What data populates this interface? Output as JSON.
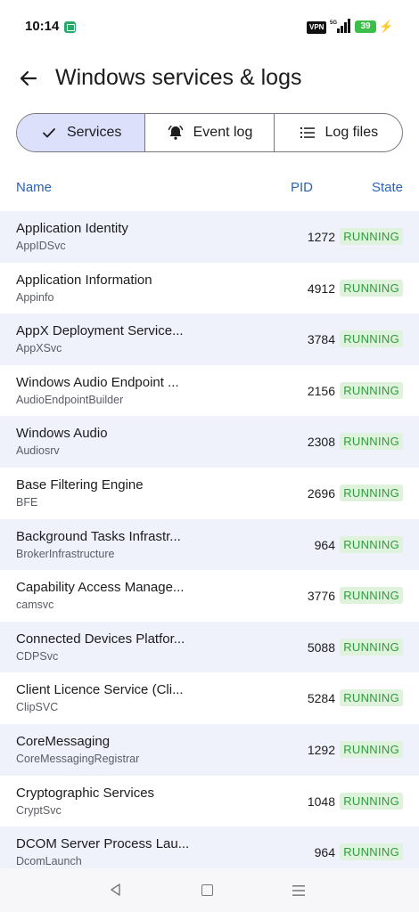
{
  "status_bar": {
    "time": "10:14",
    "vpn": "VPN",
    "battery": "39"
  },
  "header": {
    "title": "Windows services & logs"
  },
  "tabs": [
    {
      "label": "Services",
      "icon": "check-icon",
      "active": true
    },
    {
      "label": "Event log",
      "icon": "bell-icon",
      "active": false
    },
    {
      "label": "Log files",
      "icon": "list-icon",
      "active": false
    }
  ],
  "columns": {
    "name": "Name",
    "pid": "PID",
    "state": "State"
  },
  "services": [
    {
      "name": "Application Identity",
      "id": "AppIDSvc",
      "pid": "1272",
      "state": "RUNNING"
    },
    {
      "name": "Application Information",
      "id": "Appinfo",
      "pid": "4912",
      "state": "RUNNING"
    },
    {
      "name": "AppX Deployment Service...",
      "id": "AppXSvc",
      "pid": "3784",
      "state": "RUNNING"
    },
    {
      "name": "Windows Audio Endpoint ...",
      "id": "AudioEndpointBuilder",
      "pid": "2156",
      "state": "RUNNING"
    },
    {
      "name": "Windows Audio",
      "id": "Audiosrv",
      "pid": "2308",
      "state": "RUNNING"
    },
    {
      "name": "Base Filtering Engine",
      "id": "BFE",
      "pid": "2696",
      "state": "RUNNING"
    },
    {
      "name": "Background Tasks Infrastr...",
      "id": "BrokerInfrastructure",
      "pid": "964",
      "state": "RUNNING"
    },
    {
      "name": "Capability Access Manage...",
      "id": "camsvc",
      "pid": "3776",
      "state": "RUNNING"
    },
    {
      "name": "Connected Devices Platfor...",
      "id": "CDPSvc",
      "pid": "5088",
      "state": "RUNNING"
    },
    {
      "name": "Client Licence Service (Cli...",
      "id": "ClipSVC",
      "pid": "5284",
      "state": "RUNNING"
    },
    {
      "name": "CoreMessaging",
      "id": "CoreMessagingRegistrar",
      "pid": "1292",
      "state": "RUNNING"
    },
    {
      "name": "Cryptographic Services",
      "id": "CryptSvc",
      "pid": "1048",
      "state": "RUNNING"
    },
    {
      "name": "DCOM Server Process Lau...",
      "id": "DcomLaunch",
      "pid": "964",
      "state": "RUNNING"
    }
  ],
  "colors": {
    "accent": "#2a63b8",
    "active_tab": "#dde0fa",
    "row_alt": "#eff1fb",
    "running_text": "#2f9c3e",
    "running_bg": "#dff2dc"
  }
}
